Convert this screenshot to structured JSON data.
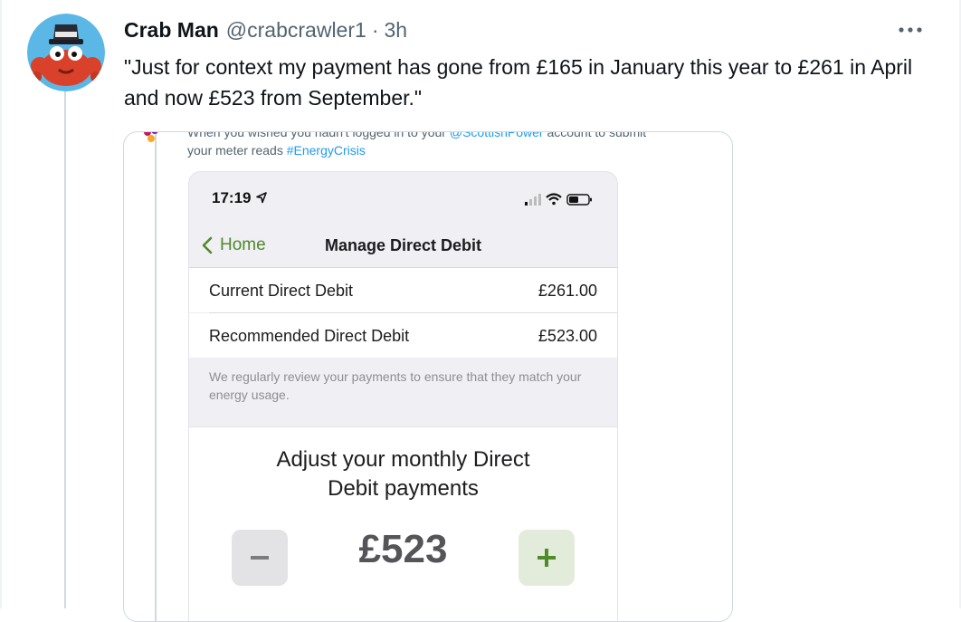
{
  "tweet": {
    "display_name": "Crab Man",
    "handle": "@crabcrawler1",
    "separator": "·",
    "time": "3h",
    "more_icon": "more-horizontal-icon",
    "text": "\"Just for context my payment has gone from £165 in January this year to £261 in April and now £523 from September.\""
  },
  "quoted_tweet": {
    "text_line1_prefix": "When you wished you hadn't logged in to your ",
    "text_line1_link": "@ScottishPower",
    "text_line1_suffix": " account to submit",
    "text_line2_prefix": "your meter reads ",
    "text_line2_hashtag": "#EnergyCrisis",
    "link_color": "#1d9bf0"
  },
  "phone_screenshot": {
    "status_time": "17:19",
    "nav": {
      "back_label": "Home",
      "title": "Manage Direct Debit"
    },
    "rows": [
      {
        "label": "Current Direct Debit",
        "value": "£261.00"
      },
      {
        "label": "Recommended Direct Debit",
        "value": "£523.00"
      }
    ],
    "note": "We regularly review your payments to ensure that they match your energy usage.",
    "adjust_title": "Adjust your monthly Direct Debit payments",
    "amount": "£523",
    "accent_color": "#4f8a2b"
  }
}
